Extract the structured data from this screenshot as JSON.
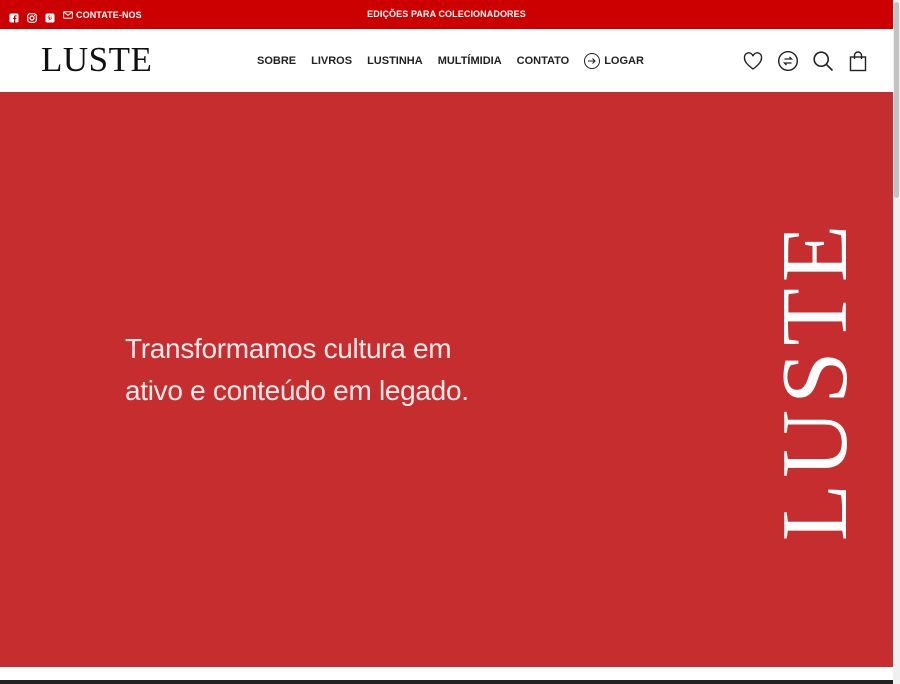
{
  "topbar": {
    "social": [
      "facebook-icon",
      "instagram-icon",
      "pinterest-icon"
    ],
    "contact_label": "CONTATE-NOS",
    "announcement": "EDIÇÕES PARA COLECIONADORES",
    "background": "#cc0000"
  },
  "header": {
    "logo": "LUSTE",
    "nav": [
      "SOBRE",
      "LIVROS",
      "LUSTINHA",
      "MULTÍMIDIA",
      "CONTATO"
    ],
    "login_label": "LOGAR",
    "icons": [
      "heart-icon",
      "exchange-icon",
      "search-icon",
      "bag-icon"
    ]
  },
  "hero": {
    "background": "#c62d2f",
    "line1": "Transformamos cultura em",
    "line2": "ativo e conteúdo em legado.",
    "vertical_logo": "LUSTE"
  }
}
